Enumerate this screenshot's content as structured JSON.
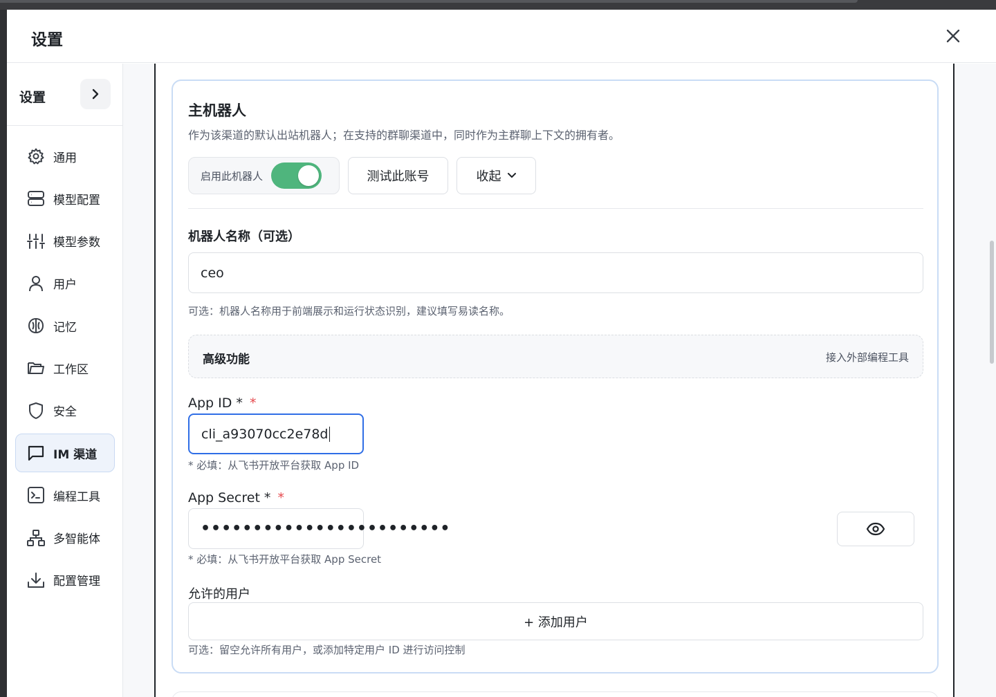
{
  "modal": {
    "title": "设置"
  },
  "sidebar": {
    "title": "设置",
    "items": [
      {
        "label": "通用",
        "icon": "gear-icon"
      },
      {
        "label": "模型配置",
        "icon": "server-icon"
      },
      {
        "label": "模型参数",
        "icon": "sliders-icon"
      },
      {
        "label": "用户",
        "icon": "user-icon"
      },
      {
        "label": "记忆",
        "icon": "brain-icon"
      },
      {
        "label": "工作区",
        "icon": "folder-icon"
      },
      {
        "label": "安全",
        "icon": "shield-icon"
      },
      {
        "label": "IM 渠道",
        "icon": "message-icon",
        "active": true
      },
      {
        "label": "编程工具",
        "icon": "terminal-icon"
      },
      {
        "label": "多智能体",
        "icon": "network-icon"
      },
      {
        "label": "配置管理",
        "icon": "download-icon"
      }
    ]
  },
  "bot": {
    "title": "主机器人",
    "description": "作为该渠道的默认出站机器人；在支持的群聊渠道中，同时作为主群聊上下文的拥有者。",
    "enable_label": "启用此机器人",
    "enabled": true,
    "test_button": "测试此账号",
    "collapse_button": "收起",
    "name_label": "机器人名称（可选）",
    "name_value": "ceo",
    "name_hint": "可选：机器人名称用于前端展示和运行状态识别，建议填写易读名称。",
    "advanced_title": "高级功能",
    "advanced_link": "接入外部编程工具",
    "app_id_label": "App ID *",
    "app_id_value": "cli_a93070cc2e78d",
    "app_id_hint": "* 必填：从飞书开放平台获取 App ID",
    "app_secret_label": "App Secret *",
    "app_secret_value": "••••••••••••••••••••••••",
    "app_secret_hint": "* 必填：从飞书开放平台获取 App Secret",
    "allowed_users_label": "允许的用户",
    "add_user_button": "+ 添加用户",
    "allowed_users_hint": "可选：留空允许所有用户，或添加特定用户 ID 进行访问控制",
    "required_mark": "*"
  },
  "colors": {
    "accent": "#2f6ee6",
    "toggle_on": "#4fb57d",
    "required": "#e5484d"
  }
}
